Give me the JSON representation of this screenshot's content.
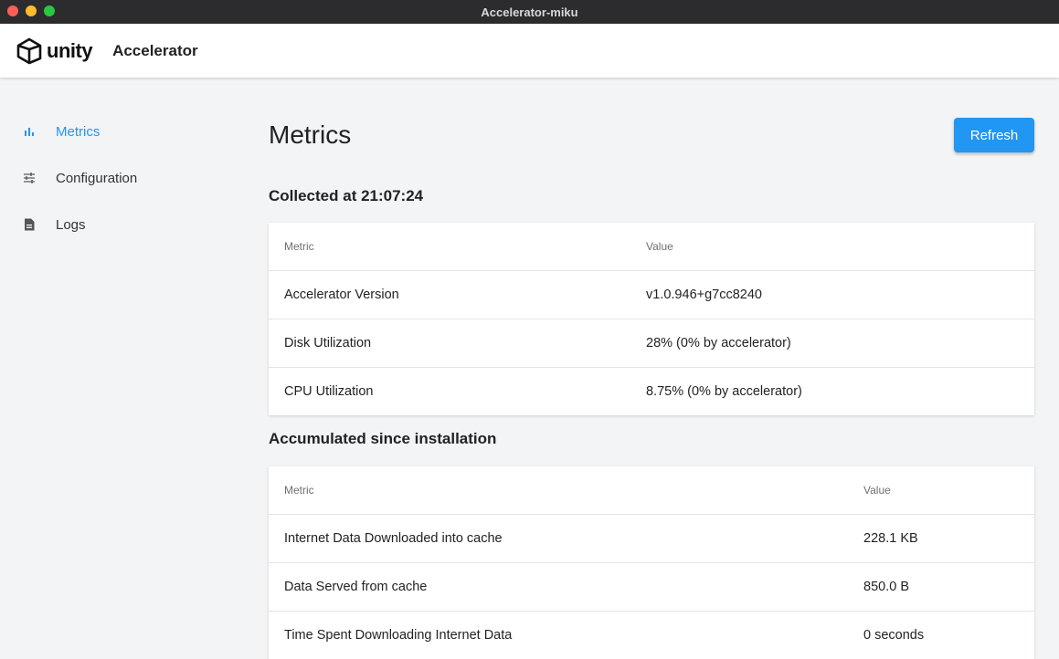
{
  "window": {
    "title": "Accelerator-miku"
  },
  "header": {
    "logo_text": "unity",
    "app_name": "Accelerator"
  },
  "sidebar": {
    "items": [
      {
        "label": "Metrics",
        "icon": "bar-chart-icon",
        "active": true
      },
      {
        "label": "Configuration",
        "icon": "sliders-icon",
        "active": false
      },
      {
        "label": "Logs",
        "icon": "document-icon",
        "active": false
      }
    ]
  },
  "main": {
    "title": "Metrics",
    "refresh_label": "Refresh",
    "collected": {
      "heading": "Collected at 21:07:24",
      "columns": [
        "Metric",
        "Value"
      ],
      "rows": [
        {
          "metric": "Accelerator Version",
          "value": "v1.0.946+g7cc8240"
        },
        {
          "metric": "Disk Utilization",
          "value": "28% (0% by accelerator)"
        },
        {
          "metric": "CPU Utilization",
          "value": "8.75% (0% by accelerator)"
        }
      ]
    },
    "accumulated": {
      "heading": "Accumulated since installation",
      "columns": [
        "Metric",
        "Value"
      ],
      "rows": [
        {
          "metric": "Internet Data Downloaded into cache",
          "value": "228.1 KB"
        },
        {
          "metric": "Data Served from cache",
          "value": "850.0 B"
        },
        {
          "metric": "Time Spent Downloading Internet Data",
          "value": "0 seconds"
        }
      ]
    }
  },
  "colors": {
    "accent": "#2196f3",
    "titlebar": "#2c2c2e",
    "background": "#f3f4f6"
  }
}
